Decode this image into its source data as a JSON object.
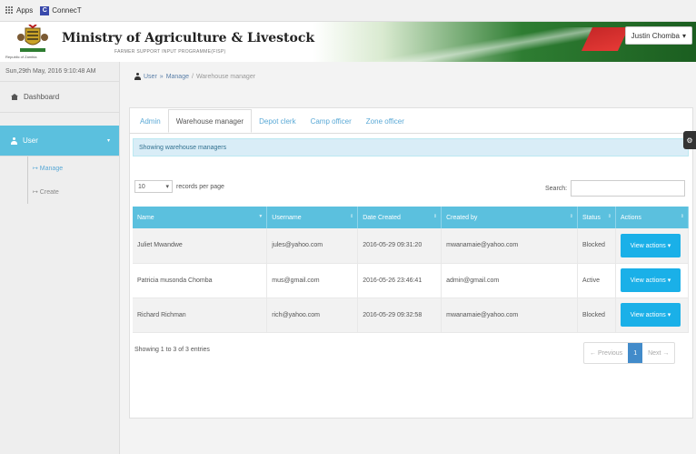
{
  "browser": {
    "bookmarks": [
      {
        "label": "Apps",
        "icon": "apps-grid-icon"
      },
      {
        "label": "ConnecT",
        "icon": "connect-app-icon"
      }
    ]
  },
  "header": {
    "ministry_title": "Ministry of Agriculture & Livestock",
    "programme": "FARMER SUPPORT INPUT PROGRAMME(FISP)",
    "coat_label": "Republic of Zambia",
    "user_name": "Justin Chomba",
    "user_caret": "▾"
  },
  "sidebar": {
    "datetime": "Sun,29th May, 2016 9:10:48 AM",
    "items": [
      {
        "label": "Dashboard",
        "icon": "home-icon"
      },
      {
        "label": "User",
        "icon": "user-icon",
        "caret": "▾"
      }
    ],
    "sub_items": [
      {
        "label": "↦ Manage"
      },
      {
        "label": "↦ Create"
      }
    ]
  },
  "breadcrumb": {
    "user": "User",
    "sep1": "»",
    "manage": "Manage",
    "sep2": "/",
    "current": "Warehouse manager"
  },
  "tabs": [
    "Admin",
    "Warehouse manager",
    "Depot clerk",
    "Camp officer",
    "Zone officer"
  ],
  "alert_text": "Showing warehouse managers",
  "table_controls": {
    "page_size": "10",
    "page_size_caret": "▾",
    "page_size_suffix": "records per page",
    "search_label": "Search:",
    "search_value": ""
  },
  "table": {
    "headers": [
      "Name",
      "Username",
      "Date Created",
      "Created by",
      "Status",
      "Actions"
    ],
    "rows": [
      [
        "Juliet Mwandwe",
        "jules@yahoo.com",
        "2016-05-29 09:31:20",
        "mwanamaie@yahoo.com",
        "Blocked",
        "View actions ▾"
      ],
      [
        "Patricia musonda Chomba",
        "mus@gmail.com",
        "2016-05-26 23:46:41",
        "admin@gmail.com",
        "Active",
        "View actions ▾"
      ],
      [
        "Richard Richman",
        "rich@yahoo.com",
        "2016-05-29 09:32:58",
        "mwanamaie@yahoo.com",
        "Blocked",
        "View actions ▾"
      ]
    ]
  },
  "info_text": "Showing 1 to 3 of 3 entries",
  "pager": {
    "prev": "← Previous",
    "current": "1",
    "next": "Next →"
  },
  "settings_glyph": "⚙",
  "colors": {
    "accent": "#5bc0de",
    "button": "#1ab0e8",
    "alert_bg": "#d9edf7",
    "pager_active": "#428bca"
  }
}
